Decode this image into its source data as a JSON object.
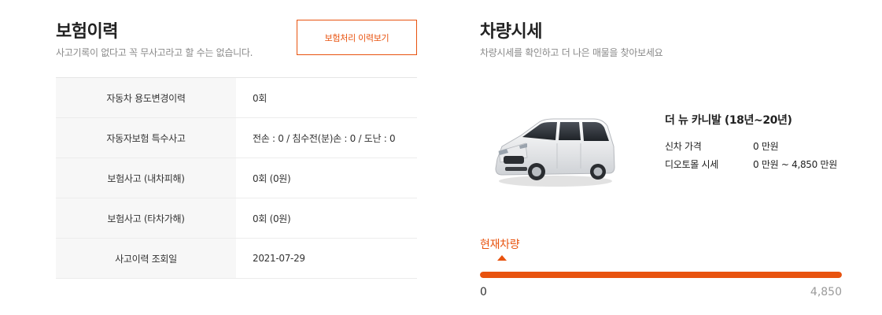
{
  "insurance": {
    "title": "보험이력",
    "subtitle": "사고기록이 없다고 꼭 무사고라고 할 수는 없습니다.",
    "button_label": "보험처리 이력보기",
    "rows": [
      {
        "label": "자동차 용도변경이력",
        "value": "0회"
      },
      {
        "label": "자동자보험 특수사고",
        "value": "전손 : 0 / 침수전(분)손 : 0 / 도난 : 0"
      },
      {
        "label": "보험사고 (내차피해)",
        "value": "0회 (0원)"
      },
      {
        "label": "보험사고 (타차가해)",
        "value": "0회 (0원)"
      },
      {
        "label": "사고이력 조회일",
        "value": "2021-07-29"
      }
    ]
  },
  "market": {
    "title": "차량시세",
    "subtitle": "차량시세를 확인하고 더 나은 매물을 찾아보세요",
    "car_name": "더 뉴 카니발 (18년~20년)",
    "new_price_label": "신차 가격",
    "new_price_value": "0 만원",
    "market_price_label": "디오토몰 시세",
    "market_price_value": "0 만원 ~ 4,850 만원",
    "current_label": "현재차량",
    "range_min": "0",
    "range_max": "4,850",
    "fill_fraction": 1.0,
    "accent_color": "#e8530f"
  }
}
